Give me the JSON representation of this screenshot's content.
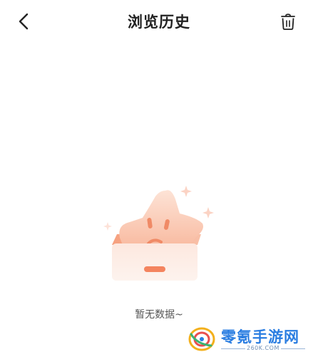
{
  "header": {
    "title": "浏览历史",
    "back_icon": "chevron-left-icon",
    "clear_icon": "trash-icon"
  },
  "empty_state": {
    "illustration": "empty-box-star-illustration",
    "message": "暂无数据~"
  },
  "watermark": {
    "name": "零氪手游网",
    "url": "260K.COM"
  },
  "colors": {
    "background": "#ffffff",
    "title": "#222222",
    "empty_text": "#555555",
    "illustration_accent": "#f4845f",
    "watermark_blue": "#2a7de1"
  }
}
